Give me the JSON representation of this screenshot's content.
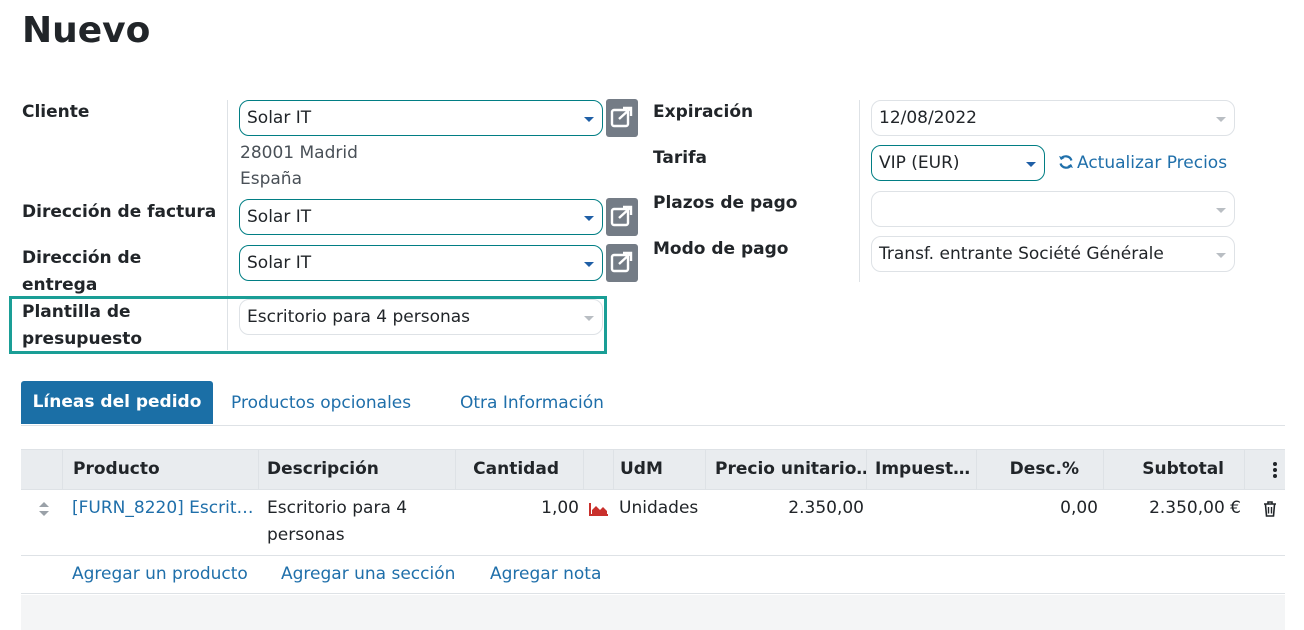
{
  "page": {
    "title": "Nuevo"
  },
  "form": {
    "customer": {
      "label": "Cliente",
      "value": "Solar IT",
      "address_line1": "28001 Madrid",
      "address_line2": "España"
    },
    "invoice_address": {
      "label": "Dirección de factura",
      "value": "Solar IT"
    },
    "delivery_address": {
      "label_line1": "Dirección de",
      "label_line2": "entrega",
      "value": "Solar IT"
    },
    "quote_template": {
      "label_line1": "Plantilla de",
      "label_line2": "presupuesto",
      "value": "Escritorio para 4 personas"
    },
    "expiration": {
      "label": "Expiración",
      "value": "12/08/2022"
    },
    "pricelist": {
      "label": "Tarifa",
      "value": "VIP (EUR)",
      "update_link": "Actualizar Precios"
    },
    "payment_terms": {
      "label": "Plazos de pago",
      "value": ""
    },
    "payment_mode": {
      "label": "Modo de pago",
      "value": "Transf. entrante Société Générale"
    }
  },
  "tabs": [
    {
      "label": "Líneas del pedido",
      "active": true
    },
    {
      "label": "Productos opcionales",
      "active": false
    },
    {
      "label": "Otra Información",
      "active": false
    }
  ],
  "table": {
    "headers": {
      "product": "Producto",
      "description": "Descripción",
      "quantity": "Cantidad",
      "uom": "UdM",
      "unit_price": "Precio unitario…",
      "taxes": "Impuest…",
      "discount": "Desc.%",
      "subtotal": "Subtotal"
    },
    "rows": [
      {
        "product": "[FURN_8220] Escrit…",
        "description_line1": "Escritorio para 4",
        "description_line2": "personas",
        "quantity": "1,00",
        "uom": "Unidades",
        "unit_price": "2.350,00",
        "taxes": "",
        "discount": "0,00",
        "subtotal": "2.350,00 €"
      }
    ],
    "add_links": {
      "product": "Agregar un producto",
      "section": "Agregar una sección",
      "note": "Agregar nota"
    }
  },
  "colors": {
    "accent": "#1b6fa6",
    "link": "#1f6faa",
    "highlight": "#1a9e96",
    "forecast_icon": "#c9302c"
  }
}
